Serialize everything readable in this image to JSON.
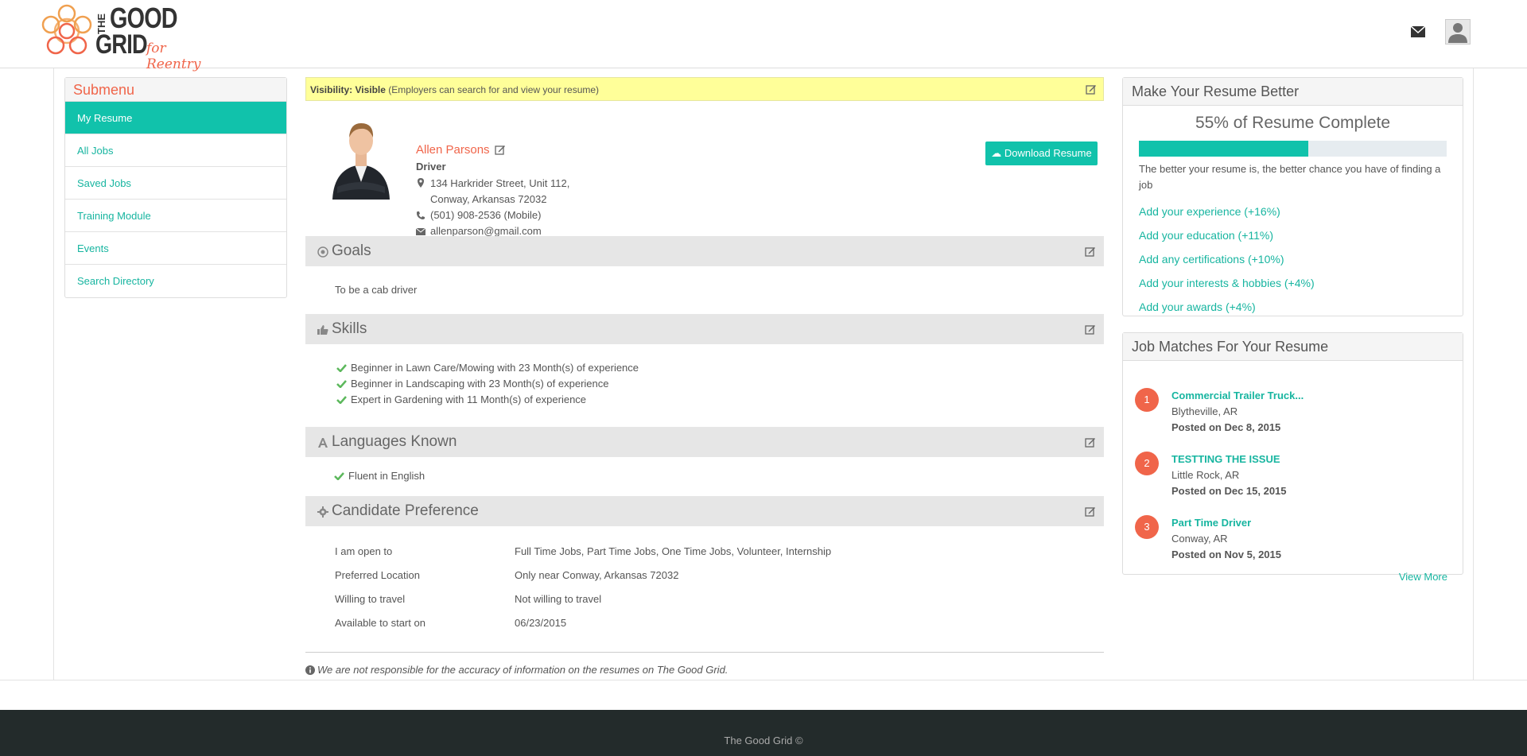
{
  "header": {
    "logo": {
      "the": "THE",
      "good": "GOOD",
      "grid": "GRID",
      "tagline": "for Reentry"
    }
  },
  "sidebar": {
    "title": "Submenu",
    "items": [
      {
        "label": "My Resume",
        "active": true
      },
      {
        "label": "All Jobs",
        "active": false
      },
      {
        "label": "Saved Jobs",
        "active": false
      },
      {
        "label": "Training Module",
        "active": false
      },
      {
        "label": "Events",
        "active": false
      },
      {
        "label": "Search Directory",
        "active": false
      }
    ]
  },
  "visibility": {
    "label": "Visibility: Visible",
    "note": "(Employers can search for and view your resume)"
  },
  "profile": {
    "name": "Allen Parsons",
    "role": "Driver",
    "address_line1": "134 Harkrider Street, Unit 112,",
    "address_line2": "Conway, Arkansas  72032",
    "phone": "(501) 908-2536 (Mobile)",
    "email": "allenparson@gmail.com",
    "download_label": "Download Resume"
  },
  "sections": {
    "goals": {
      "title": "Goals",
      "text": "To be a cab driver"
    },
    "skills": {
      "title": "Skills",
      "items": [
        "Beginner in Lawn Care/Mowing with 23  Month(s) of experience",
        "Beginner in Landscaping with 23  Month(s) of experience",
        "Expert in Gardening with 11  Month(s) of experience"
      ]
    },
    "languages": {
      "title": "Languages Known",
      "items": [
        "Fluent in English"
      ]
    },
    "preference": {
      "title": "Candidate Preference",
      "rows": [
        {
          "label": "I am open to",
          "value": "Full Time Jobs, Part Time Jobs, One Time Jobs, Volunteer, Internship"
        },
        {
          "label": "Preferred Location",
          "value": "Only near Conway, Arkansas 72032"
        },
        {
          "label": "Willing to travel",
          "value": "Not willing to travel"
        },
        {
          "label": "Available to start on",
          "value": "06/23/2015"
        }
      ]
    }
  },
  "disclaimer": "We are not responsible for the accuracy of information on the resumes on The Good Grid.",
  "resume_better": {
    "title": "Make Your Resume Better",
    "complete_label": "55% of Resume Complete",
    "progress_percent": 55,
    "description": "The better your resume is, the better chance you have of finding a job",
    "links": [
      "Add your experience (+16%)",
      "Add your education (+11%)",
      "Add any certifications (+10%)",
      "Add your interests & hobbies (+4%)",
      "Add your awards (+4%)"
    ]
  },
  "job_matches": {
    "title": "Job Matches For Your Resume",
    "jobs": [
      {
        "num": "1",
        "title": "Commercial Trailer Truck...",
        "location": "Blytheville, AR",
        "posted": "Posted on Dec 8, 2015"
      },
      {
        "num": "2",
        "title": "TESTTING THE ISSUE",
        "location": "Little Rock, AR",
        "posted": "Posted on Dec 15, 2015"
      },
      {
        "num": "3",
        "title": "Part Time Driver",
        "location": "Conway, AR",
        "posted": "Posted on Nov 5, 2015"
      }
    ],
    "view_more": "View More"
  },
  "footer": {
    "text": "The Good Grid ©"
  },
  "colors": {
    "accent": "#11c2ab",
    "brand": "#f0654a",
    "footer_bg": "#232b2b",
    "visibility_bg": "#ffff99"
  }
}
